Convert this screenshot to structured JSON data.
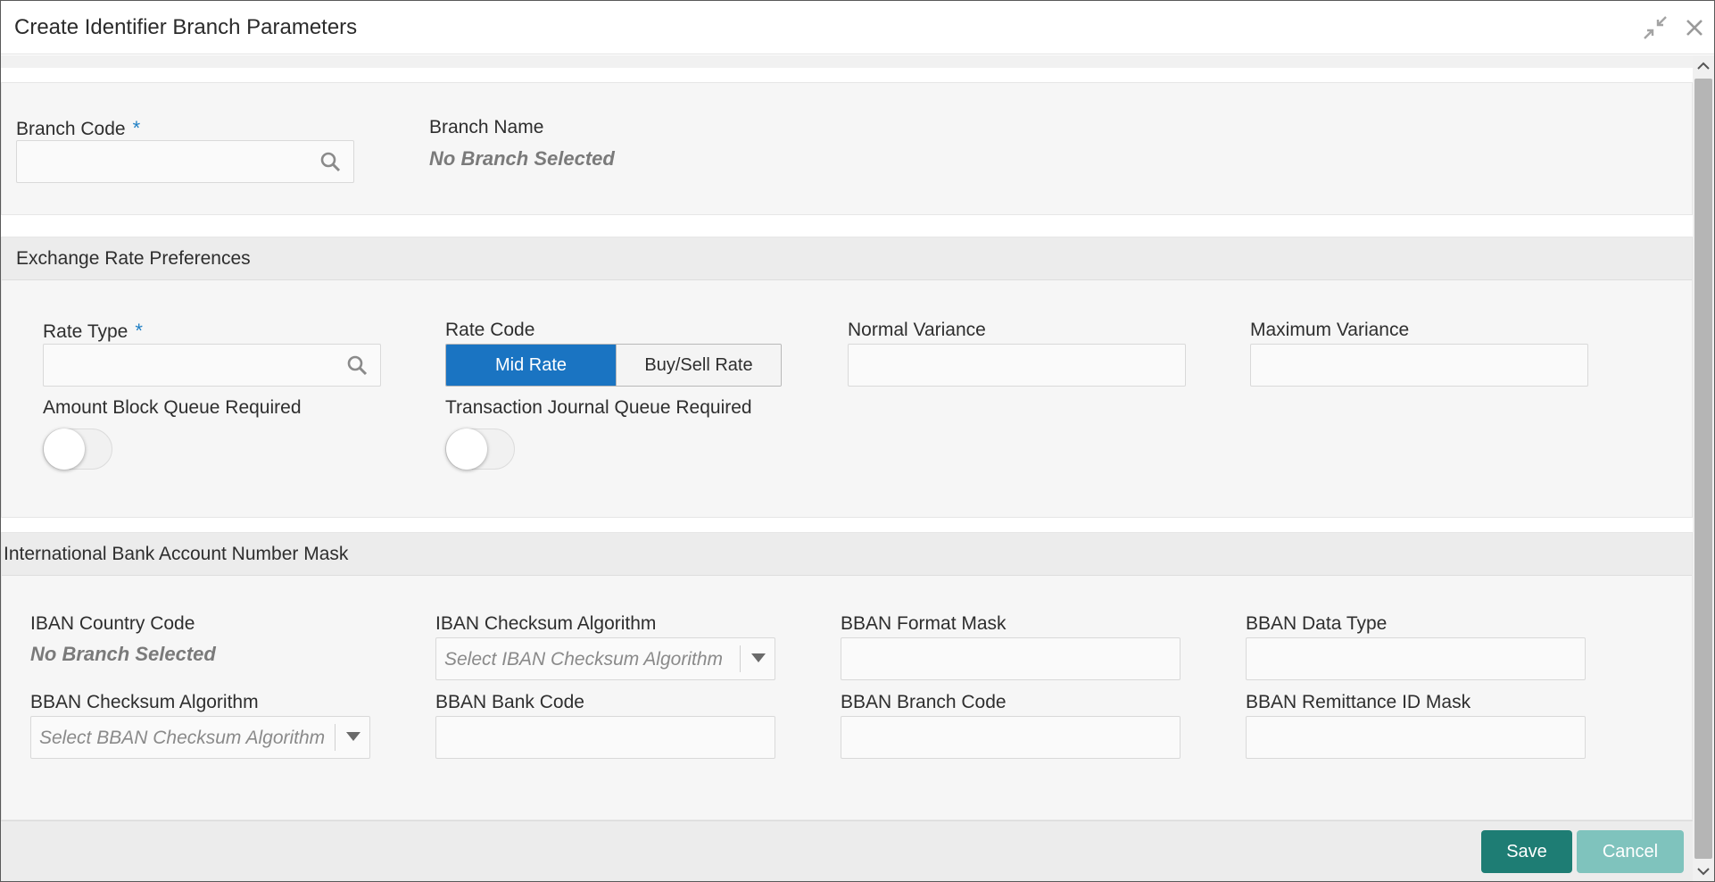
{
  "window": {
    "title": "Create Identifier Branch Parameters",
    "minimize_icon": "collapse-arrows-icon",
    "close_icon": "close-icon"
  },
  "branch": {
    "branch_code_label": "Branch Code",
    "required_mark": "*",
    "branch_code_value": "",
    "branch_name_label": "Branch Name",
    "branch_name_value": "No Branch Selected"
  },
  "exchange_rate": {
    "header": "Exchange Rate Preferences",
    "rate_type_label": "Rate Type",
    "required_mark": "*",
    "rate_type_value": "",
    "rate_code_label": "Rate Code",
    "rate_code_options": [
      "Mid Rate",
      "Buy/Sell Rate"
    ],
    "rate_code_selected": "Mid Rate",
    "normal_variance_label": "Normal Variance",
    "normal_variance_value": "",
    "maximum_variance_label": "Maximum Variance",
    "maximum_variance_value": "",
    "amount_block_label": "Amount Block Queue Required",
    "amount_block_on": false,
    "txn_journal_label": "Transaction Journal Queue Required",
    "txn_journal_on": false
  },
  "iban": {
    "header": "International Bank Account Number Mask",
    "country_code_label": "IBAN Country Code",
    "country_code_value": "No Branch Selected",
    "checksum_algo_label": "IBAN Checksum Algorithm",
    "checksum_algo_placeholder": "Select IBAN Checksum Algorithm",
    "bban_format_mask_label": "BBAN Format Mask",
    "bban_data_type_label": "BBAN Data Type",
    "bban_checksum_algo_label": "BBAN Checksum Algorithm",
    "bban_checksum_algo_placeholder": "Select BBAN Checksum Algorithm",
    "bban_bank_code_label": "BBAN Bank Code",
    "bban_branch_code_label": "BBAN Branch Code",
    "bban_remittance_label": "BBAN Remittance ID Mask"
  },
  "footer": {
    "save_label": "Save",
    "cancel_label": "Cancel"
  },
  "colors": {
    "primary_blue": "#1a74c2",
    "save_teal": "#1e7d74",
    "cancel_teal_disabled": "#7fc3bd",
    "required_blue": "#1f7fc4"
  }
}
